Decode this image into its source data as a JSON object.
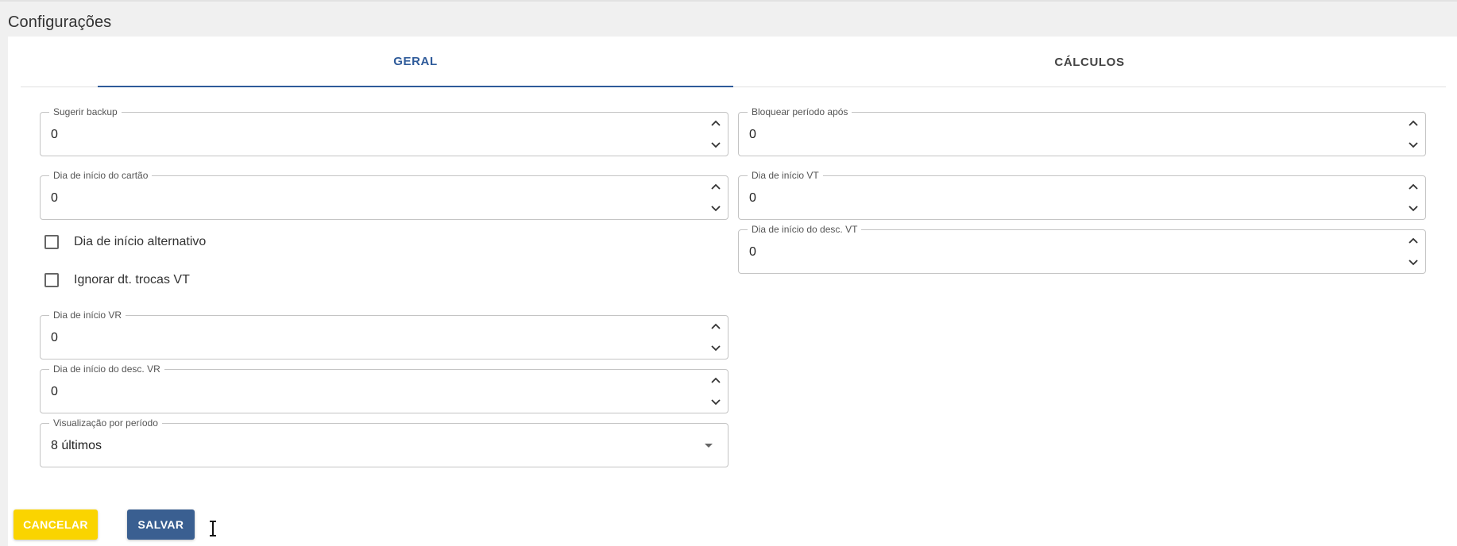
{
  "page": {
    "title": "Configurações"
  },
  "tabs": [
    {
      "label": "GERAL",
      "active": true
    },
    {
      "label": "CÁLCULOS",
      "active": false
    }
  ],
  "left_fields": {
    "sugerir_backup": {
      "label": "Sugerir backup",
      "value": "0"
    },
    "dia_inicio_cartao": {
      "label": "Dia de início do cartão",
      "value": "0"
    },
    "dia_inicio_vr": {
      "label": "Dia de início VR",
      "value": "0"
    },
    "dia_inicio_desc_vr": {
      "label": "Dia de início do desc. VR",
      "value": "0"
    },
    "visualizacao": {
      "label": "Visualização por período",
      "value": "8 últimos"
    }
  },
  "checkboxes": {
    "dia_inicio_alternativo": {
      "label": "Dia de início alternativo",
      "checked": false
    },
    "ignorar_trocas_vt": {
      "label": "Ignorar dt. trocas VT",
      "checked": false
    }
  },
  "right_fields": {
    "bloquear_periodo": {
      "label": "Bloquear período após",
      "value": "0"
    },
    "dia_inicio_vt": {
      "label": "Dia de início VT",
      "value": "0"
    },
    "dia_inicio_desc_vt": {
      "label": "Dia de início do desc. VT",
      "value": "0"
    }
  },
  "actions": {
    "cancel_label": "CANCELAR",
    "save_label": "SALVAR"
  },
  "colors": {
    "accent": "#2f5b9a",
    "cancel": "#fad400",
    "save": "#3a5f91"
  },
  "icons": {
    "spinner": [
      "chevron-up-icon",
      "chevron-down-icon"
    ],
    "select": "caret-down-icon",
    "cursor": "text-cursor-icon"
  }
}
